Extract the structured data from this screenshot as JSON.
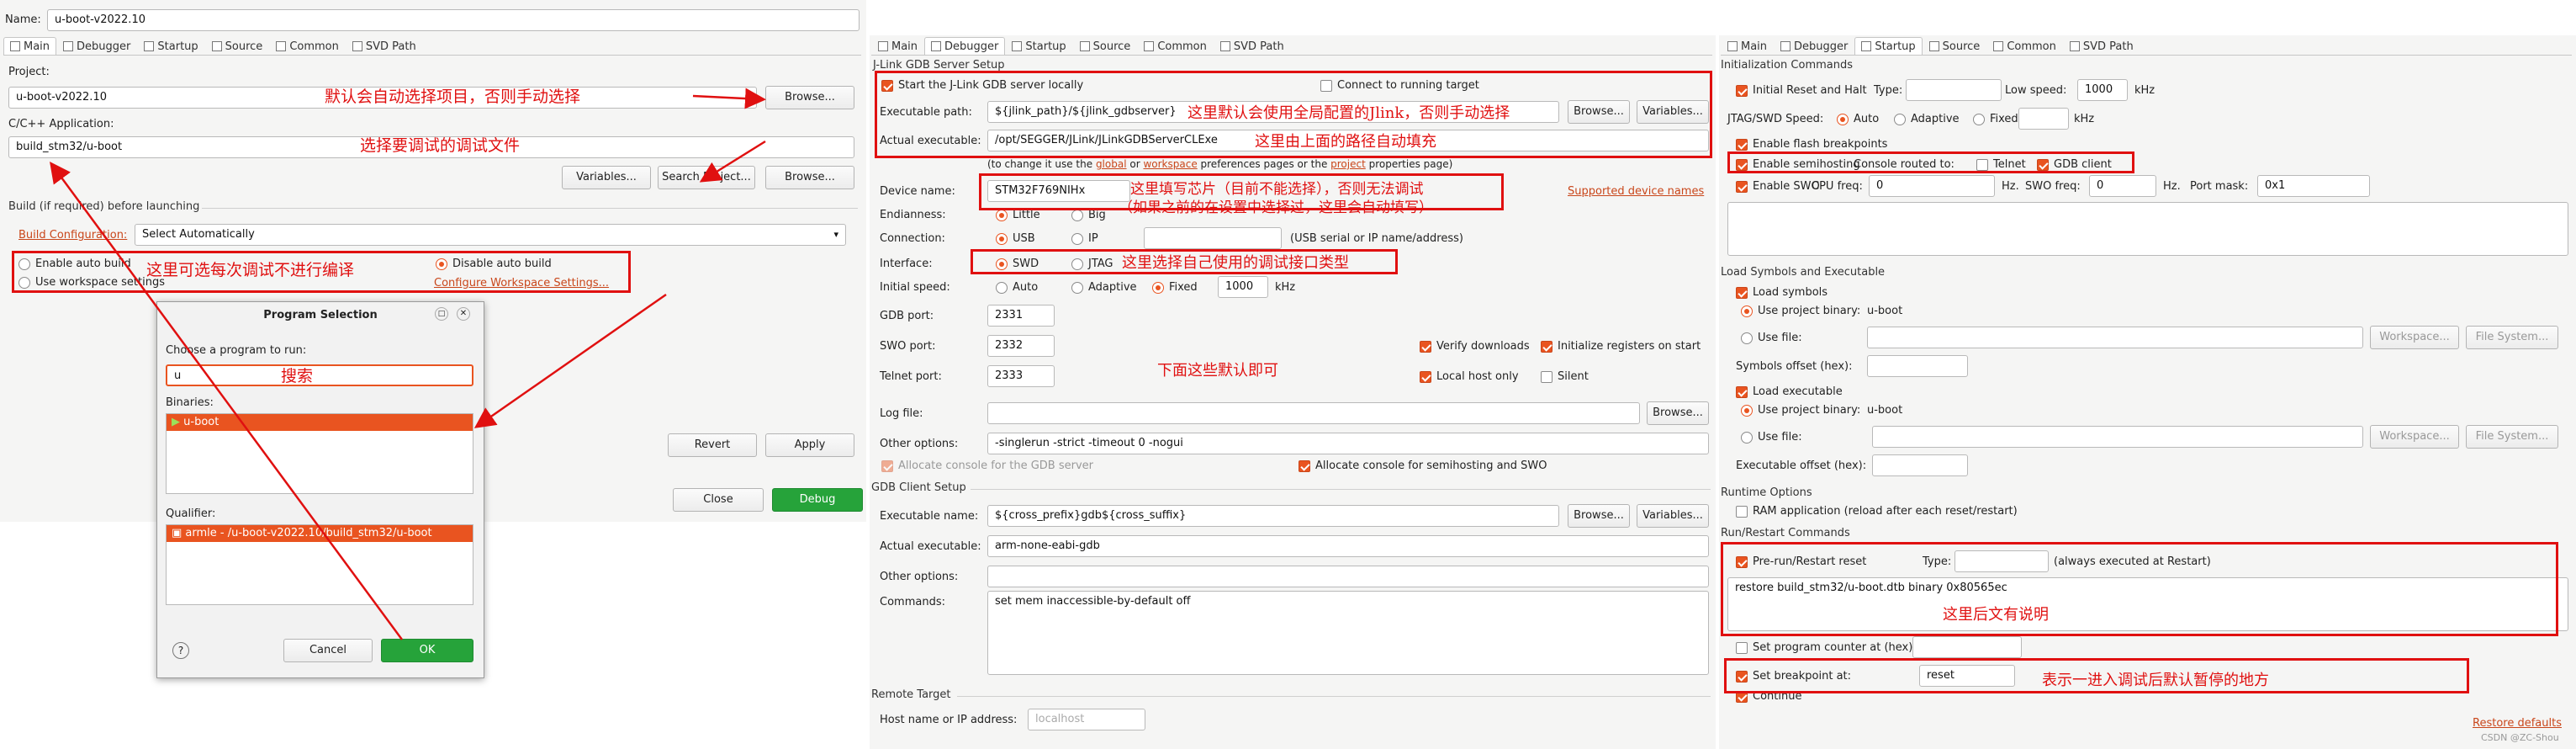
{
  "main": {
    "name_label": "Name:",
    "name_value": "u-boot-v2022.10",
    "tabs": [
      "Main",
      "Debugger",
      "Startup",
      "Source",
      "Common",
      "SVD Path"
    ],
    "project_label": "Project:",
    "project_value": "u-boot-v2022.10",
    "browse": "Browse...",
    "app_label": "C/C++ Application:",
    "app_value": "build_stm32/u-boot",
    "variables": "Variables...",
    "search_project": "Search Project...",
    "build_section": "Build (if required) before launching",
    "build_config_label": "Build Configuration:",
    "build_config_value": "Select Automatically",
    "enable_auto_build": "Enable auto build",
    "disable_auto_build": "Disable auto build",
    "use_workspace": "Use workspace settings",
    "configure_workspace": "Configure Workspace Settings...",
    "revert": "Revert",
    "apply": "Apply",
    "close": "Close",
    "debug": "Debug"
  },
  "dialog": {
    "title": "Program Selection",
    "choose_label": "Choose a program to run:",
    "search_value": "u",
    "binaries_label": "Binaries:",
    "binary": "u-boot",
    "qualifier_label": "Qualifier:",
    "qualifier": "armle - /u-boot-v2022.10/build_stm32/u-boot",
    "help": "?",
    "cancel": "Cancel",
    "ok": "OK"
  },
  "debugger": {
    "tabs": [
      "Main",
      "Debugger",
      "Startup",
      "Source",
      "Common",
      "SVD Path"
    ],
    "section": "J-Link GDB Server Setup",
    "start_local": "Start the J-Link GDB server locally",
    "connect_running": "Connect to running target",
    "exe_path_label": "Executable path:",
    "exe_path_value": "${jlink_path}/${jlink_gdbserver}",
    "browse": "Browse...",
    "variables": "Variables...",
    "actual_exe_label": "Actual executable:",
    "actual_exe_value": "/opt/SEGGER/JLink/JLinkGDBServerCLExe",
    "pref_pre": "(to change it use the ",
    "pref_global": "global",
    "pref_or": " or ",
    "pref_workspace": "workspace",
    "pref_mid": " preferences pages or the ",
    "pref_project": "project",
    "pref_post": " properties page)",
    "device_label": "Device name:",
    "device_value": "STM32F769NIHx",
    "supported_devices": "Supported device names",
    "endianness_label": "Endianness:",
    "little": "Little",
    "big": "Big",
    "connection_label": "Connection:",
    "usb": "USB",
    "ip": "IP",
    "usb_hint": "(USB serial or IP name/address)",
    "interface_label": "Interface:",
    "swd": "SWD",
    "jtag": "JTAG",
    "speed_label": "Initial speed:",
    "auto": "Auto",
    "adaptive": "Adaptive",
    "fixed": "Fixed",
    "speed_value": "1000",
    "khz": "kHz",
    "gdb_port_label": "GDB port:",
    "gdb_port": "2331",
    "swo_port_label": "SWO port:",
    "swo_port": "2332",
    "telnet_port_label": "Telnet port:",
    "telnet_port": "2333",
    "verify": "Verify downloads",
    "init_regs": "Initialize registers on start",
    "local_host": "Local host only",
    "silent": "Silent",
    "log_label": "Log file:",
    "other_label": "Other options:",
    "other_value": "-singlerun -strict -timeout 0 -nogui",
    "alloc_gdb": "Allocate console for the GDB server",
    "alloc_semi": "Allocate console for semihosting and SWO",
    "client_section": "GDB Client Setup",
    "client_exe_label": "Executable name:",
    "client_exe_value": "${cross_prefix}gdb${cross_suffix}",
    "client_actual_label": "Actual executable:",
    "client_actual_value": "arm-none-eabi-gdb",
    "client_other_label": "Other options:",
    "commands_label": "Commands:",
    "commands_value": "set mem inaccessible-by-default off",
    "remote_section": "Remote Target",
    "host_label": "Host name or IP address:",
    "host_placeholder": "localhost"
  },
  "startup": {
    "tabs": [
      "Main",
      "Debugger",
      "Startup",
      "Source",
      "Common",
      "SVD Path"
    ],
    "init_section": "Initialization Commands",
    "initial_reset": "Initial Reset and Halt",
    "type_label": "Type:",
    "low_speed_label": "Low speed:",
    "low_speed": "1000",
    "khz": "kHz",
    "jtag_speed_label": "JTAG/SWD Speed:",
    "auto": "Auto",
    "adaptive": "Adaptive",
    "fixed": "Fixed",
    "flash_bp": "Enable flash breakpoints",
    "semihosting": "Enable semihosting",
    "console_routed": "Console routed to:",
    "telnet": "Telnet",
    "gdb_client": "GDB client",
    "swo": "Enable SWO",
    "cpu_freq_label": "CPU freq:",
    "cpu_freq": "0",
    "hz": "Hz.",
    "swo_freq_label": "SWO freq:",
    "swo_freq": "0",
    "port_mask_label": "Port mask:",
    "port_mask": "0x1",
    "load_section": "Load Symbols and Executable",
    "load_symbols": "Load symbols",
    "use_binary": "Use project binary:",
    "binary_name": "u-boot",
    "use_file": "Use file:",
    "workspace_btn": "Workspace...",
    "filesystem_btn": "File System...",
    "sym_offset_label": "Symbols offset (hex):",
    "load_exe": "Load executable",
    "exe_offset_label": "Executable offset (hex):",
    "runtime_section": "Runtime Options",
    "ram_app": "RAM application (reload after each reset/restart)",
    "restart_section": "Run/Restart Commands",
    "prerun_reset": "Pre-run/Restart reset",
    "always": "(always executed at Restart)",
    "restore_cmd": "restore build_stm32/u-boot.dtb binary 0x80565ec",
    "set_pc": "Set program counter at (hex):",
    "set_bp": "Set breakpoint at:",
    "bp_value": "reset",
    "continue": "Continue",
    "restore_defaults": "Restore defaults",
    "watermark": "CSDN @ZC-Shou"
  },
  "notes": {
    "n1": "默认会自动选择项目，否则手动选择",
    "n2": "选择要调试的调试文件",
    "n3": "这里可选每次调试不进行编译",
    "n4": "搜索",
    "n5": "这里默认会使用全局配置的Jlink，否则手动选择",
    "n6": "这里由上面的路径自动填充",
    "n7a": "这里填写芯片（目前不能选择），否则无法调试",
    "n7b": "（如果之前的在设置中选择过，这里会自动填写）",
    "n8": "这里选择自己使用的调试接口类型",
    "n9": "下面这些默认即可",
    "n10": "这里后文有说明",
    "n11": "表示一进入调试后默认暂停的地方"
  }
}
